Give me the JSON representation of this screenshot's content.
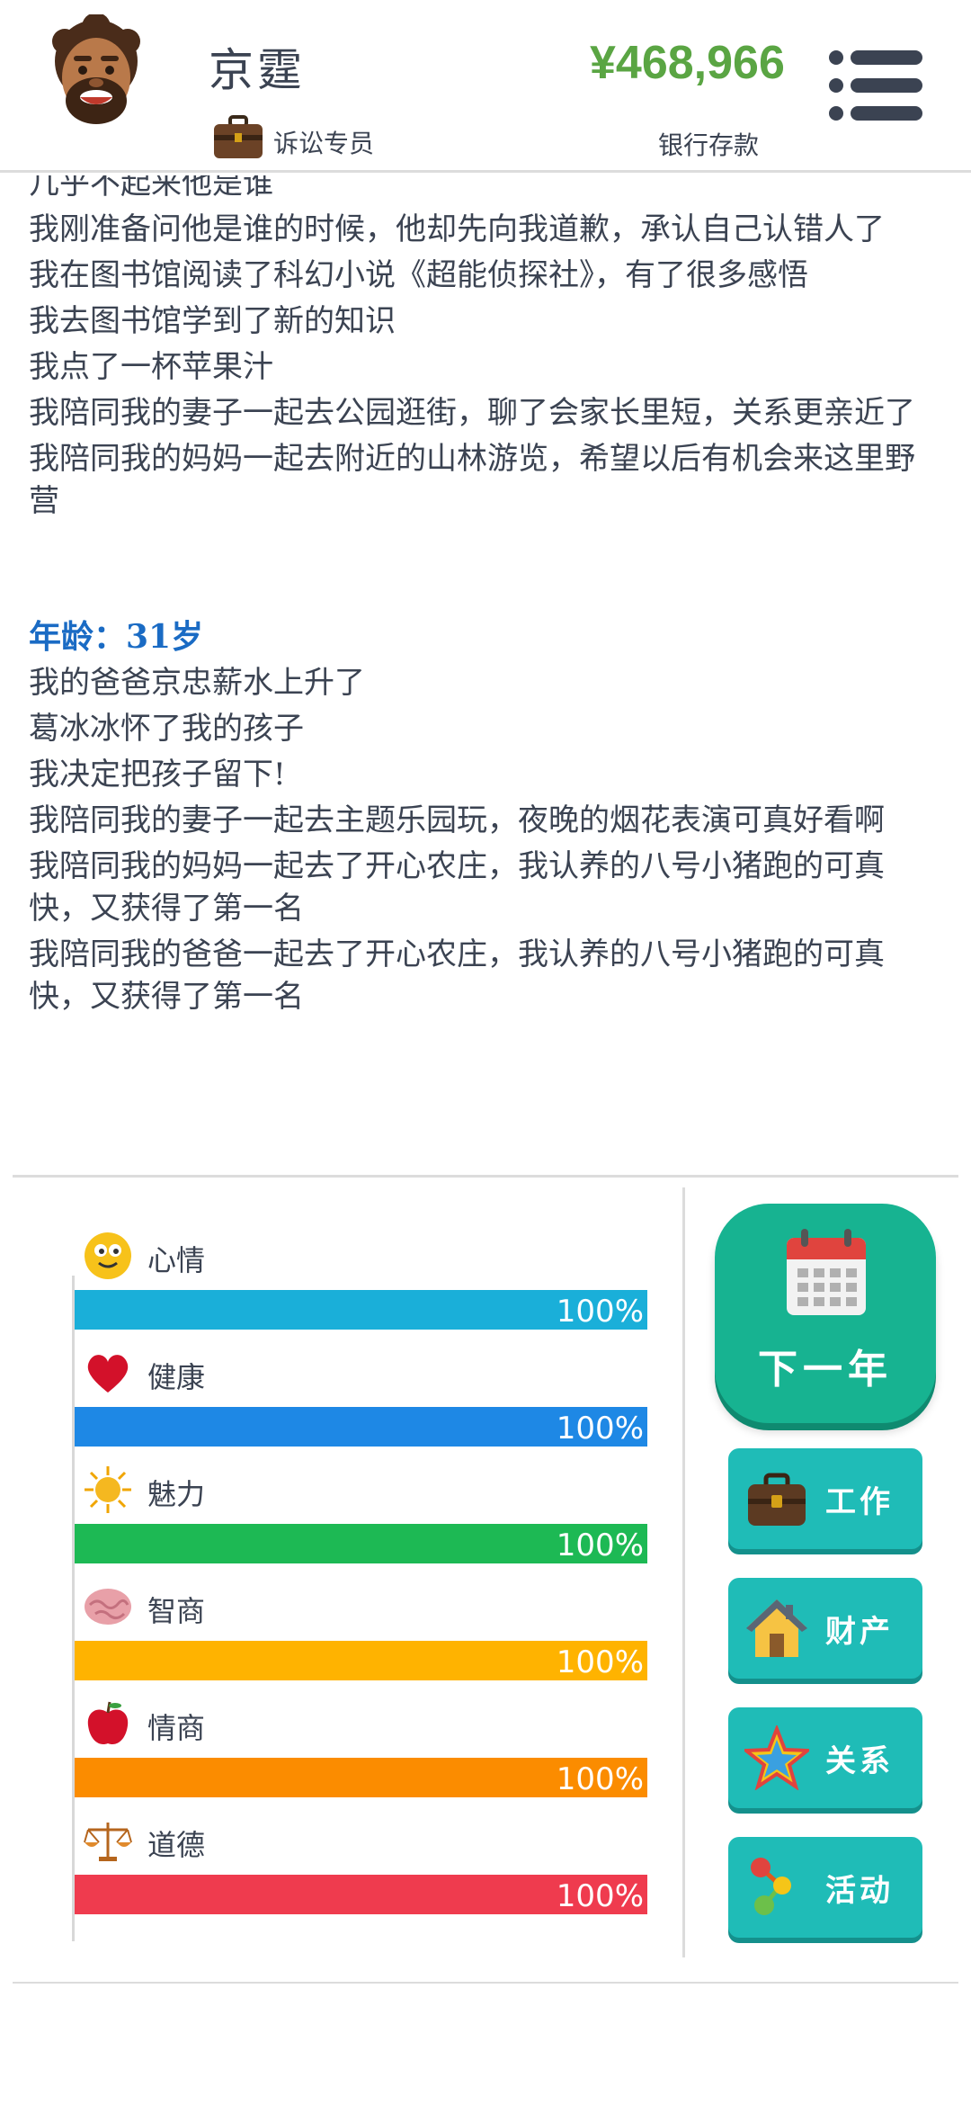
{
  "header": {
    "name": "京霆",
    "job_title": "诉讼专员",
    "money": "¥468,966",
    "money_label": "银行存款"
  },
  "log": {
    "lines_before": [
      "几乎不起来他是谁",
      "我刚准备问他是谁的时候，他却先向我道歉，承认自己认错人了",
      "我在图书馆阅读了科幻小说《超能侦探社》，有了很多感悟",
      "我去图书馆学到了新的知识",
      "我点了一杯苹果汁",
      "我陪同我的妻子一起去公园逛街，聊了会家长里短，关系更亲近了",
      "我陪同我的妈妈一起去附近的山林游览，希望以后有机会来这里野营"
    ],
    "age_heading": "年龄：31岁",
    "lines_after": [
      "我的爸爸京忠薪水上升了",
      "葛冰冰怀了我的孩子",
      "我决定把孩子留下!",
      "我陪同我的妻子一起去主题乐园玩，夜晚的烟花表演可真好看啊",
      "我陪同我的妈妈一起去了开心农庄，我认养的八号小猪跑的可真快，又获得了第一名",
      "我陪同我的爸爸一起去了开心农庄，我认养的八号小猪跑的可真快，又获得了第一名"
    ]
  },
  "stats": [
    {
      "label": "心情",
      "percent": "100%",
      "value": 1.0,
      "color": "#1aafd9",
      "icon": "smiley-icon"
    },
    {
      "label": "健康",
      "percent": "100%",
      "value": 1.0,
      "color": "#1e88e5",
      "icon": "heart-icon"
    },
    {
      "label": "魅力",
      "percent": "100%",
      "value": 1.0,
      "color": "#1db954",
      "icon": "sun-icon"
    },
    {
      "label": "智商",
      "percent": "100%",
      "value": 1.0,
      "color": "#ffb300",
      "icon": "brain-icon"
    },
    {
      "label": "情商",
      "percent": "100%",
      "value": 1.0,
      "color": "#fb8c00",
      "icon": "apple-icon"
    },
    {
      "label": "道德",
      "percent": "100%",
      "value": 1.0,
      "color": "#ef3b4e",
      "icon": "scales-icon"
    }
  ],
  "actions": {
    "next_year": "下一年",
    "work": "工作",
    "property": "财产",
    "relations": "关系",
    "activities": "活动"
  }
}
